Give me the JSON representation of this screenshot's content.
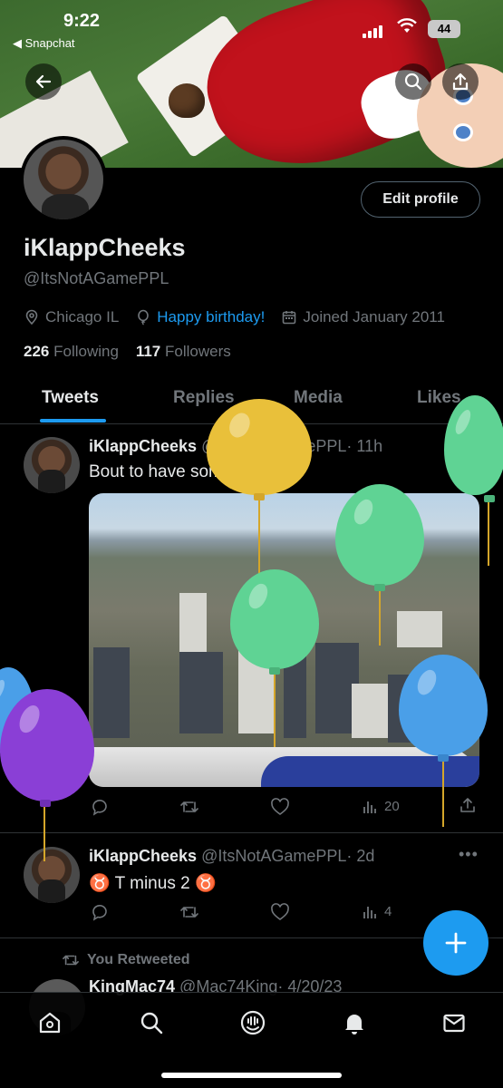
{
  "status_bar": {
    "time": "9:22",
    "back_app": "◀ Snapchat",
    "battery": "44"
  },
  "profile": {
    "name": "iKlappCheeks",
    "handle": "@ItsNotAGamePPL",
    "edit_label": "Edit profile",
    "location": "Chicago IL",
    "birthday": "Happy birthday!",
    "joined": "Joined January 2011",
    "following_count": "226",
    "following_label": "Following",
    "followers_count": "117",
    "followers_label": "Followers"
  },
  "tabs": [
    {
      "label": "Tweets",
      "active": true
    },
    {
      "label": "Replies",
      "active": false
    },
    {
      "label": "Media",
      "active": false
    },
    {
      "label": "Likes",
      "active": false
    }
  ],
  "tweets": [
    {
      "name": "iKlappCheeks",
      "handle": "@ItsNotAGamePPL",
      "time": "· 11h",
      "text": "Bout to have some fun",
      "views": "20"
    },
    {
      "name": "iKlappCheeks",
      "handle": "@ItsNotAGamePPL",
      "time": "· 2d",
      "text": "♉ T minus 2 ♉",
      "views": "4"
    }
  ],
  "retweet": {
    "label": "You Retweeted",
    "name": "KingMac74",
    "handle": "@Mac74King",
    "time": "· 4/20/23"
  },
  "colors": {
    "accent": "#1d9bf0",
    "background": "#000000",
    "balloon_yellow": "#f0c73c",
    "balloon_green": "#5fd394",
    "balloon_blue": "#4a9fe8",
    "balloon_purple": "#8a3fd6"
  },
  "icons": [
    "back-arrow-icon",
    "search-icon",
    "share-icon",
    "location-icon",
    "balloon-icon",
    "calendar-icon",
    "reply-icon",
    "retweet-icon",
    "like-icon",
    "views-icon",
    "home-icon",
    "spaces-icon",
    "bell-icon",
    "mail-icon"
  ]
}
